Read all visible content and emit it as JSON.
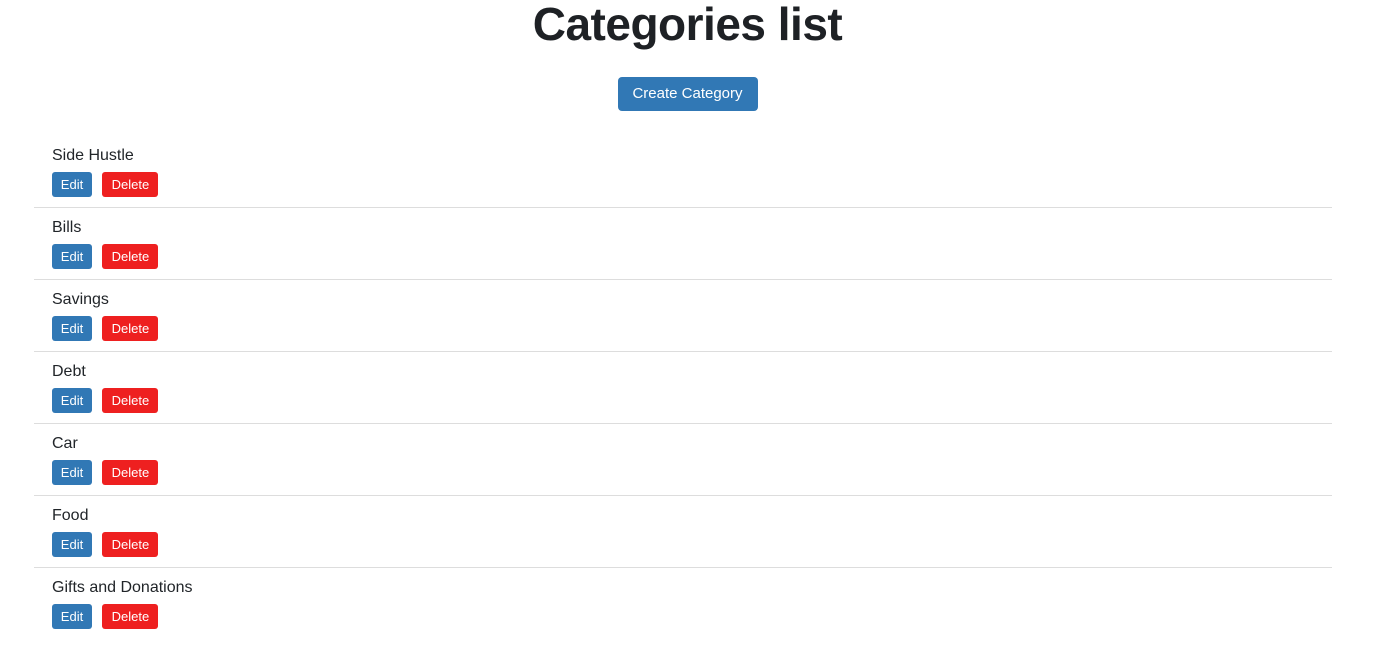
{
  "header": {
    "title": "Categories list",
    "create_button_label": "Create Category"
  },
  "colors": {
    "primary_blue": "#3178b5",
    "danger_red": "#ee2020",
    "divider": "#dddddd",
    "title_text": "#1e2125",
    "body_text": "#212529",
    "background": "#ffffff"
  },
  "actions": {
    "edit_label": "Edit",
    "delete_label": "Delete"
  },
  "list": {
    "rows": [
      {
        "name": "Side Hustle",
        "edit_label": "Edit",
        "delete_label": "Delete"
      },
      {
        "name": "Bills",
        "edit_label": "Edit",
        "delete_label": "Delete"
      },
      {
        "name": "Savings",
        "edit_label": "Edit",
        "delete_label": "Delete"
      },
      {
        "name": "Debt",
        "edit_label": "Edit",
        "delete_label": "Delete"
      },
      {
        "name": "Car",
        "edit_label": "Edit",
        "delete_label": "Delete"
      },
      {
        "name": "Food",
        "edit_label": "Edit",
        "delete_label": "Delete"
      },
      {
        "name": "Gifts and Donations",
        "edit_label": "Edit",
        "delete_label": "Delete"
      }
    ]
  }
}
